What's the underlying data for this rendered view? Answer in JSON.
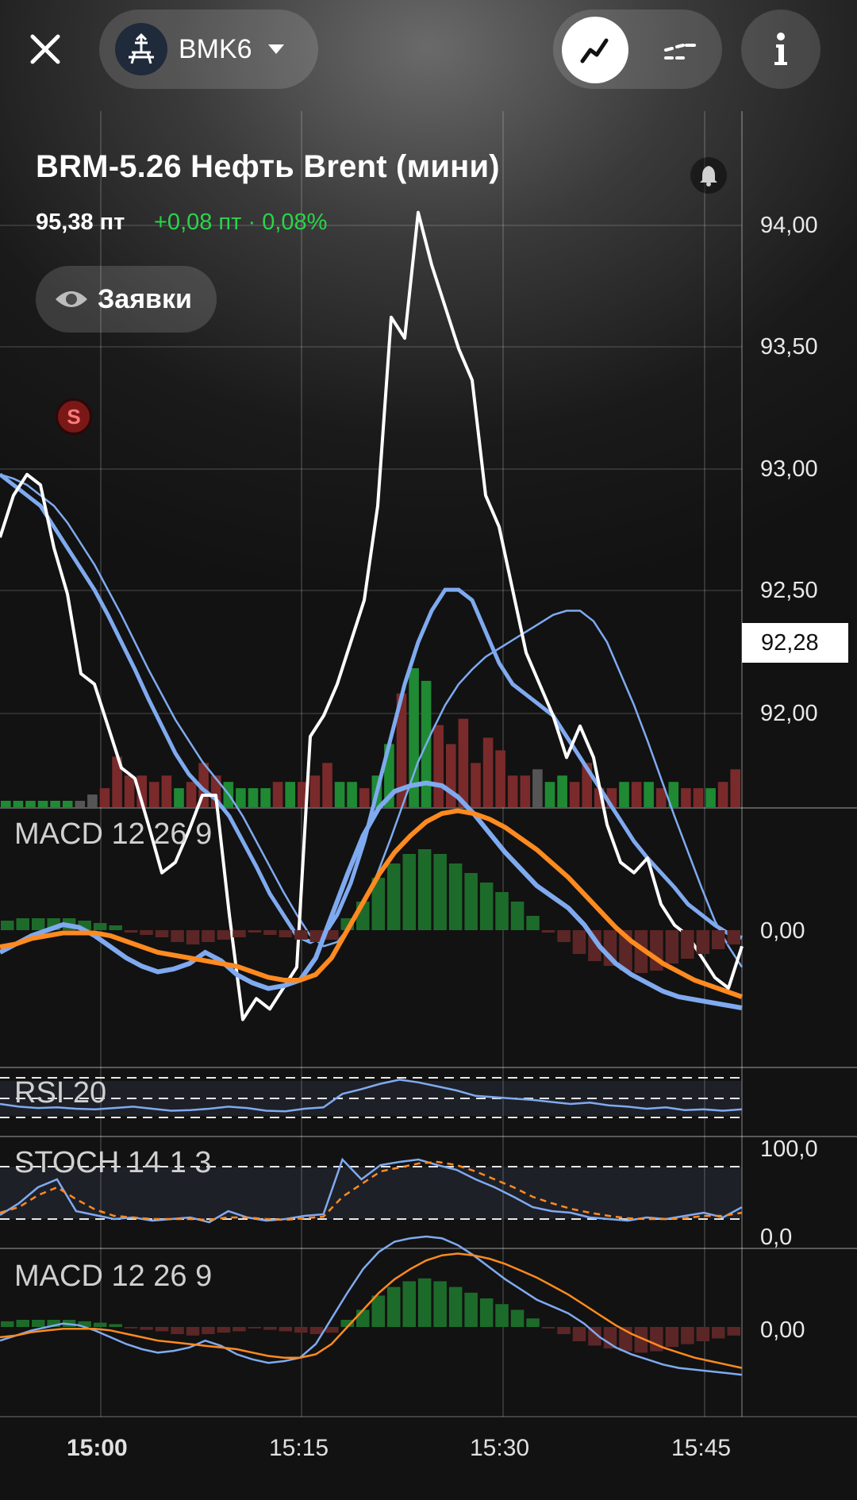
{
  "header": {
    "close_icon": "close-icon",
    "ticker": "BMK6",
    "ticker_icon": "oil-rig-icon",
    "dropdown_icon": "chevron-down-icon",
    "mode_line_icon": "line-chart-icon",
    "mode_compare_icon": "compare-lines-icon",
    "info_icon": "info-icon"
  },
  "instrument": {
    "title": "BRM-5.26 Нефть Brent (мини)",
    "price": "95,38 пт",
    "change": "+0,08 пт · 0,08%",
    "change_color": "#2bd34a",
    "orders_label": "Заявки",
    "bell_icon": "bell-icon"
  },
  "signal_marker": "S",
  "last_price_label": "92,28",
  "y_axis": [
    "94,00",
    "93,50",
    "93,00",
    "92,50",
    "92,00"
  ],
  "indicators": {
    "macd_label": "MACD 12 26 9",
    "macd_zero": "0,00",
    "rsi_label": "RSI 20",
    "stoch_label": "STOCH 14 1 3",
    "stoch_top": "100,0",
    "stoch_bottom": "0,0",
    "macd2_label": "MACD 12 26 9",
    "macd2_zero": "0,00"
  },
  "time_axis": [
    "15:00",
    "15:15",
    "15:30",
    "15:45"
  ],
  "chart_data": {
    "type": "line",
    "x_start": "14:53",
    "x_step_minutes": 1,
    "ylim": [
      91.7,
      94.35
    ],
    "price": [
      92.65,
      92.85,
      92.95,
      92.9,
      92.6,
      92.38,
      92.0,
      91.95,
      91.75,
      91.55,
      91.5,
      91.28,
      91.05,
      91.1,
      91.25,
      91.42,
      91.42,
      90.85,
      90.35,
      90.45,
      90.4,
      90.5,
      90.6,
      91.7,
      91.8,
      91.95,
      92.15,
      92.35,
      92.8,
      93.7,
      93.6,
      94.2,
      93.95,
      93.75,
      93.55,
      93.4,
      92.85,
      92.7,
      92.4,
      92.1,
      91.95,
      91.8,
      91.6,
      91.75,
      91.6,
      91.28,
      91.1,
      91.05,
      91.12,
      90.9,
      90.8,
      90.75,
      90.65,
      90.55,
      90.5,
      90.7
    ],
    "ma_fast": [
      92.95,
      92.9,
      92.85,
      92.8,
      92.7,
      92.6,
      92.5,
      92.4,
      92.28,
      92.15,
      92.02,
      91.88,
      91.75,
      91.62,
      91.52,
      91.45,
      91.4,
      91.32,
      91.2,
      91.08,
      90.95,
      90.85,
      90.75,
      90.72,
      90.75,
      90.85,
      91.0,
      91.2,
      91.45,
      91.7,
      91.95,
      92.15,
      92.3,
      92.4,
      92.4,
      92.35,
      92.2,
      92.05,
      91.95,
      91.9,
      91.85,
      91.8,
      91.7,
      91.6,
      91.5,
      91.4,
      91.3,
      91.2,
      91.12,
      91.05,
      90.98,
      90.9,
      90.85,
      90.8,
      90.76,
      90.74
    ],
    "ma_slow": [
      92.95,
      92.93,
      92.9,
      92.85,
      92.8,
      92.72,
      92.62,
      92.52,
      92.4,
      92.28,
      92.15,
      92.02,
      91.9,
      91.78,
      91.68,
      91.58,
      91.5,
      91.42,
      91.32,
      91.2,
      91.08,
      90.96,
      90.85,
      90.75,
      90.7,
      90.72,
      90.8,
      90.9,
      91.05,
      91.22,
      91.4,
      91.58,
      91.72,
      91.85,
      91.95,
      92.02,
      92.08,
      92.12,
      92.16,
      92.2,
      92.24,
      92.28,
      92.3,
      92.3,
      92.25,
      92.15,
      92.0,
      91.85,
      91.68,
      91.5,
      91.32,
      91.15,
      90.98,
      90.82,
      90.7,
      90.6
    ],
    "volume": [
      1,
      1,
      1,
      1,
      1,
      1,
      1,
      2,
      3,
      8,
      5,
      5,
      4,
      5,
      3,
      4,
      7,
      5,
      4,
      3,
      3,
      3,
      4,
      4,
      4,
      5,
      7,
      4,
      4,
      3,
      5,
      10,
      18,
      22,
      20,
      13,
      10,
      14,
      7,
      11,
      9,
      5,
      5,
      6,
      4,
      5,
      4,
      7,
      3,
      3,
      4,
      4,
      4,
      3,
      4,
      3,
      3,
      3,
      4,
      6
    ],
    "volume_color": [
      "g",
      "g",
      "g",
      "g",
      "g",
      "g",
      "n",
      "n",
      "r",
      "r",
      "r",
      "r",
      "r",
      "r",
      "g",
      "r",
      "r",
      "r",
      "g",
      "g",
      "g",
      "g",
      "r",
      "g",
      "r",
      "r",
      "r",
      "g",
      "g",
      "r",
      "g",
      "g",
      "r",
      "g",
      "g",
      "r",
      "r",
      "r",
      "r",
      "r",
      "r",
      "r",
      "r",
      "n",
      "g",
      "g",
      "r",
      "r",
      "r",
      "r",
      "g",
      "r",
      "g",
      "r",
      "g",
      "r",
      "r",
      "g",
      "r",
      "r"
    ],
    "macd": [
      -0.08,
      -0.05,
      -0.02,
      0.0,
      0.02,
      0.01,
      -0.02,
      -0.06,
      -0.1,
      -0.13,
      -0.15,
      -0.14,
      -0.12,
      -0.08,
      -0.11,
      -0.16,
      -0.19,
      -0.21,
      -0.2,
      -0.18,
      -0.1,
      0.05,
      0.2,
      0.34,
      0.44,
      0.5,
      0.52,
      0.53,
      0.52,
      0.48,
      0.42,
      0.35,
      0.28,
      0.22,
      0.16,
      0.12,
      0.08,
      0.02,
      -0.06,
      -0.12,
      -0.16,
      -0.19,
      -0.22,
      -0.24,
      -0.25,
      -0.26,
      -0.27,
      -0.28
    ],
    "macd_signal": [
      -0.06,
      -0.05,
      -0.03,
      -0.02,
      -0.01,
      -0.01,
      -0.01,
      -0.02,
      -0.04,
      -0.06,
      -0.08,
      -0.09,
      -0.1,
      -0.11,
      -0.12,
      -0.13,
      -0.15,
      -0.17,
      -0.18,
      -0.18,
      -0.16,
      -0.1,
      0.0,
      0.1,
      0.2,
      0.28,
      0.34,
      0.39,
      0.42,
      0.43,
      0.42,
      0.4,
      0.37,
      0.33,
      0.29,
      0.24,
      0.19,
      0.13,
      0.07,
      0.01,
      -0.04,
      -0.08,
      -0.12,
      -0.15,
      -0.18,
      -0.2,
      -0.22,
      -0.24
    ],
    "macd_hist": [
      0.04,
      0.05,
      0.05,
      0.05,
      0.05,
      0.04,
      0.03,
      0.02,
      -0.01,
      -0.02,
      -0.03,
      -0.05,
      -0.06,
      -0.05,
      -0.04,
      -0.03,
      -0.01,
      -0.02,
      -0.03,
      -0.04,
      -0.05,
      -0.04,
      0.05,
      0.12,
      0.22,
      0.28,
      0.32,
      0.34,
      0.32,
      0.28,
      0.24,
      0.2,
      0.16,
      0.12,
      0.06,
      -0.01,
      -0.05,
      -0.1,
      -0.13,
      -0.15,
      -0.17,
      -0.18,
      -0.17,
      -0.14,
      -0.12,
      -0.1,
      -0.08,
      -0.06
    ],
    "rsi": [
      40,
      36,
      34,
      35,
      33,
      32,
      34,
      36,
      33,
      30,
      31,
      33,
      36,
      34,
      30,
      29,
      33,
      35,
      55,
      62,
      70,
      76,
      72,
      66,
      60,
      52,
      50,
      48,
      46,
      43,
      40,
      42,
      38,
      36,
      33,
      35,
      31,
      32,
      30,
      32
    ],
    "stoch_k": [
      25,
      40,
      60,
      70,
      30,
      25,
      20,
      22,
      18,
      20,
      22,
      16,
      30,
      22,
      18,
      20,
      24,
      26,
      95,
      70,
      88,
      92,
      95,
      88,
      82,
      70,
      60,
      48,
      35,
      30,
      28,
      22,
      20,
      18,
      22,
      20,
      24,
      28,
      22,
      35
    ],
    "stoch_d": [
      28,
      35,
      50,
      60,
      45,
      32,
      24,
      22,
      20,
      20,
      20,
      19,
      22,
      22,
      20,
      19,
      21,
      23,
      48,
      64,
      80,
      85,
      90,
      92,
      88,
      80,
      70,
      60,
      48,
      40,
      33,
      28,
      24,
      21,
      20,
      20,
      21,
      24,
      24,
      28
    ]
  }
}
